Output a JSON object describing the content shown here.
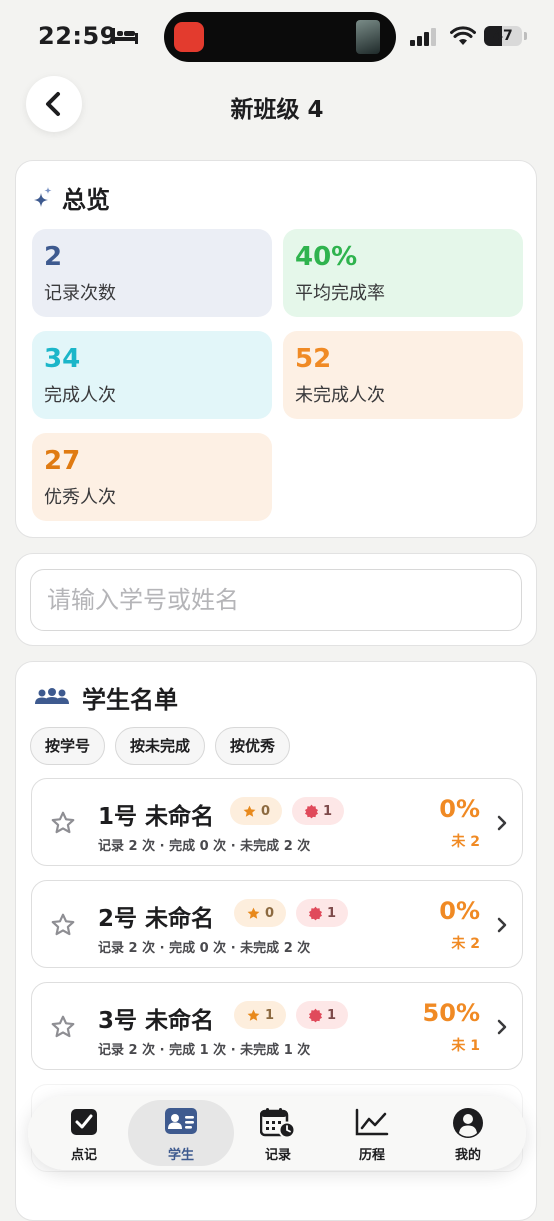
{
  "status_bar": {
    "time": "22:59",
    "battery": "47"
  },
  "nav": {
    "title": "新班级 4"
  },
  "overview": {
    "title": "总览",
    "stats": [
      {
        "value": "2",
        "label": "记录次数"
      },
      {
        "value": "40%",
        "label": "平均完成率"
      },
      {
        "value": "34",
        "label": "完成人次"
      },
      {
        "value": "52",
        "label": "未完成人次"
      },
      {
        "value": "27",
        "label": "优秀人次"
      }
    ]
  },
  "search": {
    "placeholder": "请输入学号或姓名"
  },
  "roster": {
    "title": "学生名单",
    "sort_chips": [
      "按学号",
      "按未完成",
      "按优秀"
    ],
    "students": [
      {
        "name": "1号  未命名",
        "excellent": "0",
        "missing": "1",
        "detail": "记录 2 次 · 完成 0 次 · 未完成 2 次",
        "rate": "0%",
        "miss": "未 2"
      },
      {
        "name": "2号  未命名",
        "excellent": "0",
        "missing": "1",
        "detail": "记录 2 次 · 完成 0 次 · 未完成 2 次",
        "rate": "0%",
        "miss": "未 2"
      },
      {
        "name": "3号  未命名",
        "excellent": "1",
        "missing": "1",
        "detail": "记录 2 次 · 完成 1 次 · 未完成 1 次",
        "rate": "50%",
        "miss": "未 1"
      }
    ]
  },
  "tabs": [
    {
      "label": "点记",
      "icon": "checkbox-icon"
    },
    {
      "label": "学生",
      "icon": "student-card-icon",
      "active": true
    },
    {
      "label": "记录",
      "icon": "calendar-clock-icon"
    },
    {
      "label": "历程",
      "icon": "trend-chart-icon"
    },
    {
      "label": "我的",
      "icon": "profile-icon"
    }
  ],
  "colors": {
    "accent": "#3e5a8f",
    "orange": "#f08a24",
    "green": "#2fb34e",
    "cyan": "#1bb6c9"
  }
}
